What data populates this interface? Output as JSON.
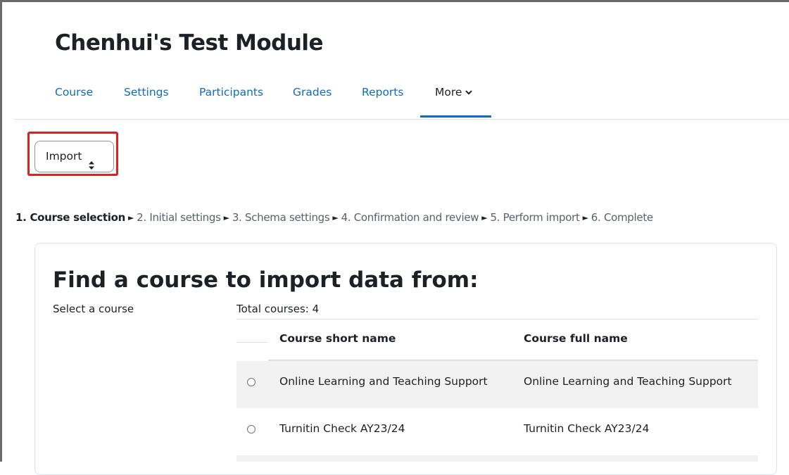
{
  "page": {
    "title": "Chenhui's Test Module"
  },
  "nav": {
    "items": [
      {
        "label": "Course"
      },
      {
        "label": "Settings"
      },
      {
        "label": "Participants"
      },
      {
        "label": "Grades"
      },
      {
        "label": "Reports"
      },
      {
        "label": "More",
        "active": true,
        "icon": "chevron-down-icon"
      }
    ]
  },
  "action_select": {
    "value": "Import",
    "icon": "up-down-arrows-icon"
  },
  "steps": [
    {
      "label": "1. Course selection",
      "current": true
    },
    {
      "label": "2. Initial settings"
    },
    {
      "label": "3. Schema settings"
    },
    {
      "label": "4. Confirmation and review"
    },
    {
      "label": "5. Perform import"
    },
    {
      "label": "6. Complete"
    }
  ],
  "step_separator": "►",
  "search": {
    "heading": "Find a course to import data from:",
    "select_label": "Select a course",
    "total": "Total courses: 4",
    "columns": {
      "short": "Course short name",
      "full": "Course full name"
    },
    "rows": [
      {
        "short": "Online Learning and Teaching Support",
        "full": "Online Learning and Teaching Support"
      },
      {
        "short": "Turnitin Check AY23/24",
        "full": "Turnitin Check AY23/24"
      }
    ]
  },
  "colors": {
    "link": "#0f6cbf",
    "highlight": "#e02020",
    "row_stripe": "#f2f2f2",
    "text": "#1d2125"
  }
}
